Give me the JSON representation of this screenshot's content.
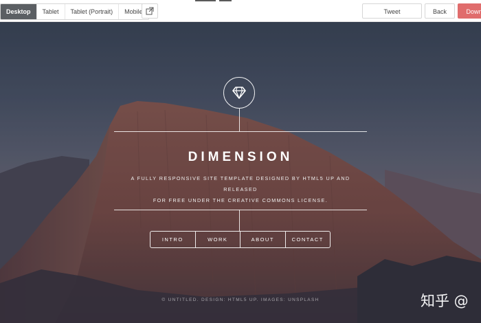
{
  "toolbar": {
    "view_tabs": [
      {
        "label": "Desktop",
        "active": true
      },
      {
        "label": "Tablet",
        "active": false
      },
      {
        "label": "Tablet (Portrait)",
        "active": false
      },
      {
        "label": "Mobile",
        "active": false
      }
    ],
    "external_icon": "external-link-icon",
    "tweet_label": "Tweet",
    "back_label": "Back",
    "download_label": "Down",
    "accent_color": "#e06c6c"
  },
  "site": {
    "logo_icon": "diamond-icon",
    "title": "DIMENSION",
    "description_line1": "A fully responsive site template designed by HTML5 UP and released",
    "description_line2": "for free under the Creative Commons license.",
    "nav": [
      "INTRO",
      "WORK",
      "ABOUT",
      "CONTACT"
    ],
    "footer": "© Untitled. Design: HTML5 UP. Images: Unsplash"
  },
  "watermark": "知乎 @"
}
